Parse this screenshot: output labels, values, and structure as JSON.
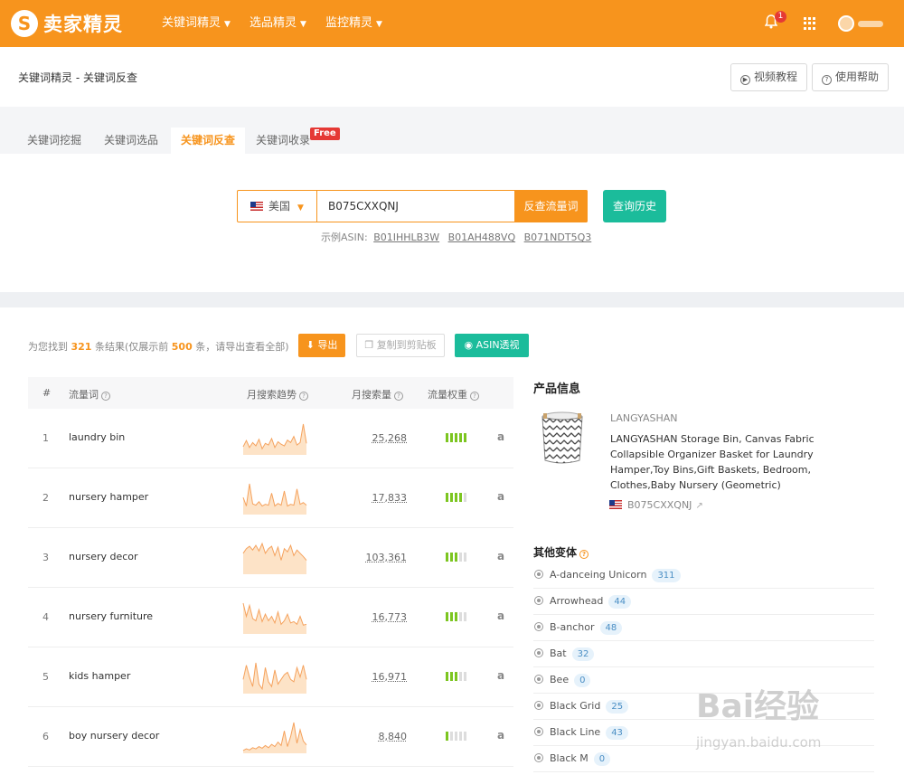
{
  "brand": {
    "logo_glyph": "S",
    "name": "卖家精灵",
    "accent": "#f7941d",
    "teal": "#1bbc9b"
  },
  "nav": {
    "items": [
      {
        "label": "关键词精灵"
      },
      {
        "label": "选品精灵"
      },
      {
        "label": "监控精灵"
      }
    ],
    "notification_count": "1"
  },
  "header": {
    "breadcrumb": "关键词精灵 - 关键词反查",
    "video_button": "视频教程",
    "help_button": "使用帮助"
  },
  "tabs": [
    {
      "label": "关键词挖掘"
    },
    {
      "label": "关键词选品"
    },
    {
      "label": "关键词反查",
      "active": true
    },
    {
      "label": "关键词收录"
    }
  ],
  "free_badge": "Free",
  "search": {
    "country": "美国",
    "asin_value": "B075CXXQNJ",
    "search_button": "反查流量词",
    "history_button": "查询历史",
    "examples_label": "示例ASIN:",
    "examples": [
      "B01IHHLB3W",
      "B01AH488VQ",
      "B071NDT5Q3"
    ]
  },
  "results": {
    "summary_prefix": "为您找到",
    "total": "321",
    "summary_mid": "条结果(仅展示前",
    "shown": "500",
    "summary_suffix": "条，请导出查看全部)",
    "export_button": "导出",
    "copy_button": "复制到剪贴板",
    "asin_button": "ASIN透视"
  },
  "table": {
    "headers": {
      "index": "#",
      "keyword": "流量词",
      "trend": "月搜索趋势",
      "volume": "月搜索量",
      "weight": "流量权重"
    },
    "rows": [
      {
        "index": "1",
        "keyword": "laundry bin",
        "volume": "25,268",
        "weight": 5,
        "trend": [
          20,
          35,
          18,
          30,
          22,
          38,
          15,
          28,
          24,
          40,
          18,
          32,
          26,
          22,
          36,
          30,
          45,
          24,
          30,
          75,
          28
        ]
      },
      {
        "index": "2",
        "keyword": "nursery hamper",
        "volume": "17,833",
        "weight": 4,
        "trend": [
          40,
          20,
          72,
          25,
          22,
          30,
          20,
          24,
          22,
          50,
          20,
          26,
          22,
          55,
          20,
          24,
          22,
          60,
          24,
          28,
          22
        ]
      },
      {
        "index": "3",
        "keyword": "nursery decor",
        "volume": "103,361",
        "weight": 3,
        "trend": [
          45,
          55,
          60,
          52,
          62,
          50,
          66,
          45,
          55,
          60,
          40,
          58,
          30,
          55,
          48,
          62,
          40,
          52,
          45,
          38,
          30
        ]
      },
      {
        "index": "4",
        "keyword": "nursery furniture",
        "volume": "16,773",
        "weight": 3,
        "trend": [
          70,
          40,
          65,
          35,
          30,
          55,
          28,
          45,
          30,
          40,
          25,
          50,
          22,
          30,
          45,
          25,
          28,
          22,
          40,
          20,
          22
        ]
      },
      {
        "index": "5",
        "keyword": "kids hamper",
        "volume": "16,971",
        "weight": 3,
        "trend": [
          30,
          60,
          35,
          15,
          65,
          20,
          10,
          55,
          25,
          15,
          50,
          20,
          30,
          40,
          45,
          30,
          25,
          55,
          35,
          60,
          30
        ]
      },
      {
        "index": "6",
        "keyword": "boy nursery decor",
        "volume": "8,840",
        "weight": 1,
        "trend": [
          5,
          8,
          6,
          10,
          8,
          12,
          9,
          14,
          10,
          16,
          12,
          20,
          14,
          40,
          12,
          30,
          55,
          18,
          42,
          22,
          15
        ]
      }
    ]
  },
  "product": {
    "section_title": "产品信息",
    "brand": "LANGYASHAN",
    "name": "LANGYASHAN Storage Bin, Canvas Fabric Collapsible Organizer Basket for Laundry Hamper,Toy Bins,Gift Baskets, Bedroom, Clothes,Baby Nursery (Geometric)",
    "asin": "B075CXXQNJ"
  },
  "variants": {
    "section_title": "其他变体",
    "items": [
      {
        "label": "A-danceing Unicorn",
        "count": "311"
      },
      {
        "label": "Arrowhead",
        "count": "44"
      },
      {
        "label": "B-anchor",
        "count": "48"
      },
      {
        "label": "Bat",
        "count": "32"
      },
      {
        "label": "Bee",
        "count": "0"
      },
      {
        "label": "Black Grid",
        "count": "25"
      },
      {
        "label": "Black Line",
        "count": "43"
      },
      {
        "label": "Black M",
        "count": "0"
      }
    ]
  },
  "watermark": {
    "logo": "Bai经验",
    "url": "jingyan.baidu.com"
  }
}
